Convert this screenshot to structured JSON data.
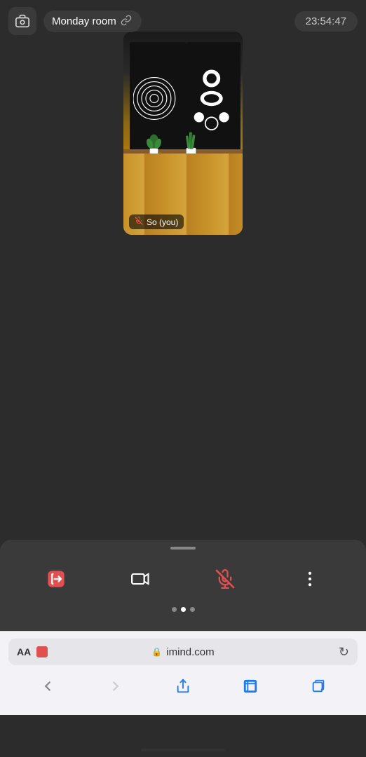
{
  "header": {
    "room_name": "Monday room",
    "time": "23:54:47",
    "camera_icon": "camera-icon",
    "link_icon": "🔗"
  },
  "participant": {
    "name": "So  (you)",
    "mic_muted": true
  },
  "controls": {
    "leave_icon": "leave",
    "camera_icon": "camera",
    "mic_icon": "mic",
    "more_icon": "more",
    "page_dots": [
      false,
      true,
      false
    ]
  },
  "browser": {
    "aa_label": "AA",
    "url_domain": "imind.com",
    "lock_icon": "lock",
    "refresh_icon": "↻",
    "nav": {
      "back": "‹",
      "forward": "›",
      "share": "share",
      "bookmarks": "bookmarks",
      "tabs": "tabs"
    }
  }
}
